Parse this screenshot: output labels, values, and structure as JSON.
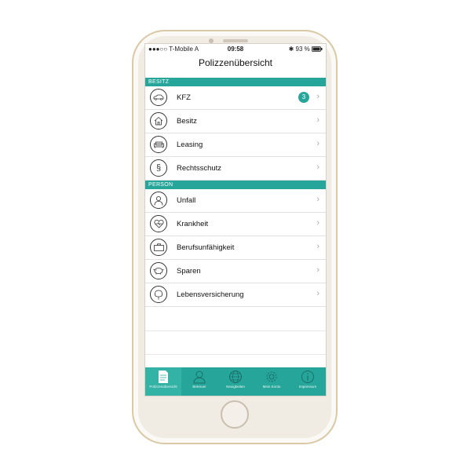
{
  "status_bar": {
    "carrier": "●●●○○ T-Mobile A",
    "time": "09:58",
    "battery": "93 %"
  },
  "nav": {
    "title": "Polizzenübersicht"
  },
  "sections": [
    {
      "header": "BESITZ",
      "items": [
        {
          "label": "KFZ",
          "badge": "3",
          "icon": "car-icon"
        },
        {
          "label": "Besitz",
          "icon": "house-icon"
        },
        {
          "label": "Leasing",
          "icon": "sofa-icon"
        },
        {
          "label": "Rechtsschutz",
          "icon": "paragraph-icon"
        }
      ]
    },
    {
      "header": "PERSON",
      "items": [
        {
          "label": "Unfall",
          "icon": "person-icon"
        },
        {
          "label": "Krankheit",
          "icon": "heart-pulse-icon"
        },
        {
          "label": "Berufsunfähigkeit",
          "icon": "briefcase-icon"
        },
        {
          "label": "Sparen",
          "icon": "piggy-bank-icon"
        },
        {
          "label": "Lebensversicherung",
          "icon": "tree-icon"
        }
      ]
    }
  ],
  "tabbar": [
    {
      "label": "Polizzenübersicht",
      "icon": "document-icon"
    },
    {
      "label": "Betreuer",
      "icon": "user-icon"
    },
    {
      "label": "Neuigkeiten",
      "icon": "globe-icon"
    },
    {
      "label": "Mein Konto",
      "icon": "gear-icon"
    },
    {
      "label": "Impressum",
      "icon": "info-icon"
    }
  ],
  "colors": {
    "accent": "#26a69a",
    "phone_body": "#f1ece3",
    "phone_rim": "#d9c9a6"
  }
}
